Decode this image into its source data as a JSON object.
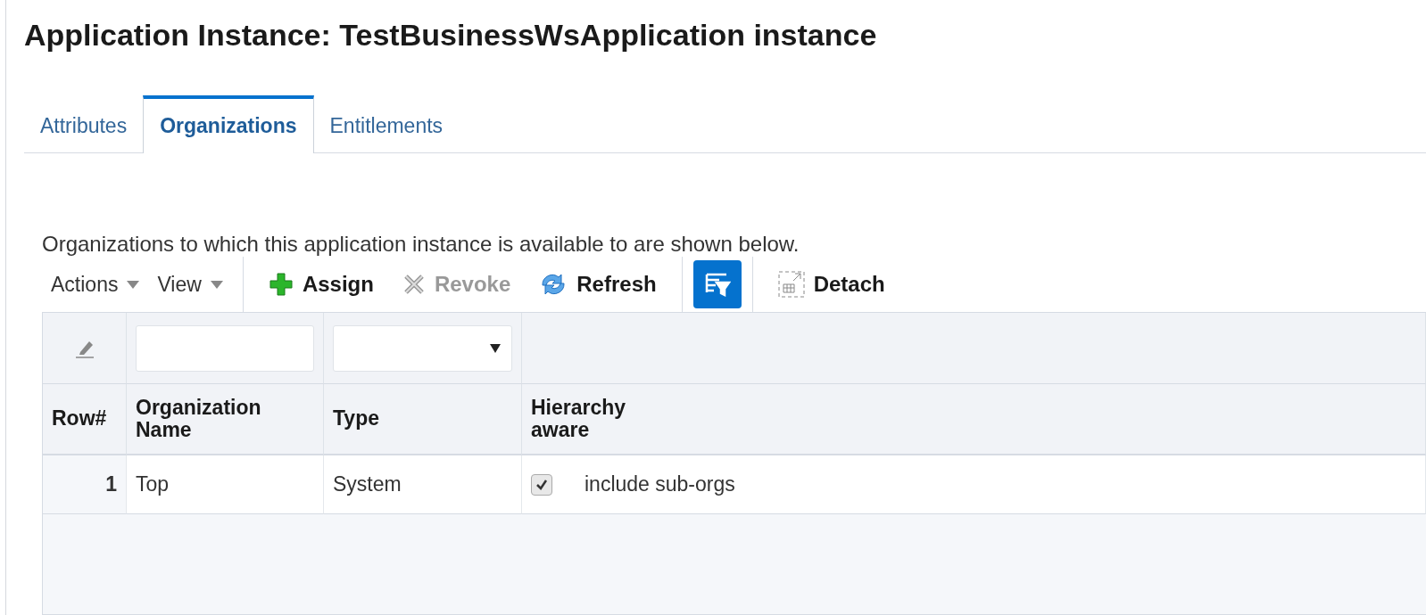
{
  "title": "Application Instance: TestBusinessWsApplication instance",
  "tabs": [
    {
      "label": "Attributes",
      "selected": false
    },
    {
      "label": "Organizations",
      "selected": true
    },
    {
      "label": "Entitlements",
      "selected": false
    }
  ],
  "description": "Organizations to which this application instance is available to are shown below.",
  "toolbar": {
    "menus": [
      {
        "label": "Actions"
      },
      {
        "label": "View"
      }
    ],
    "buttons": [
      {
        "kind": "assign",
        "label": "Assign",
        "disabled": false
      },
      {
        "kind": "revoke",
        "label": "Revoke",
        "disabled": true
      },
      {
        "kind": "refresh",
        "label": "Refresh",
        "disabled": false
      }
    ],
    "filter_toggle": {
      "selected": true
    },
    "detach": {
      "label": "Detach"
    }
  },
  "table": {
    "columns": [
      "Row#",
      "Organization Name",
      "Type",
      "Hierarchy aware"
    ],
    "rows": [
      {
        "row": "1",
        "name": "Top",
        "type": "System",
        "checked": true,
        "check_label": "include sub-orgs"
      }
    ]
  }
}
